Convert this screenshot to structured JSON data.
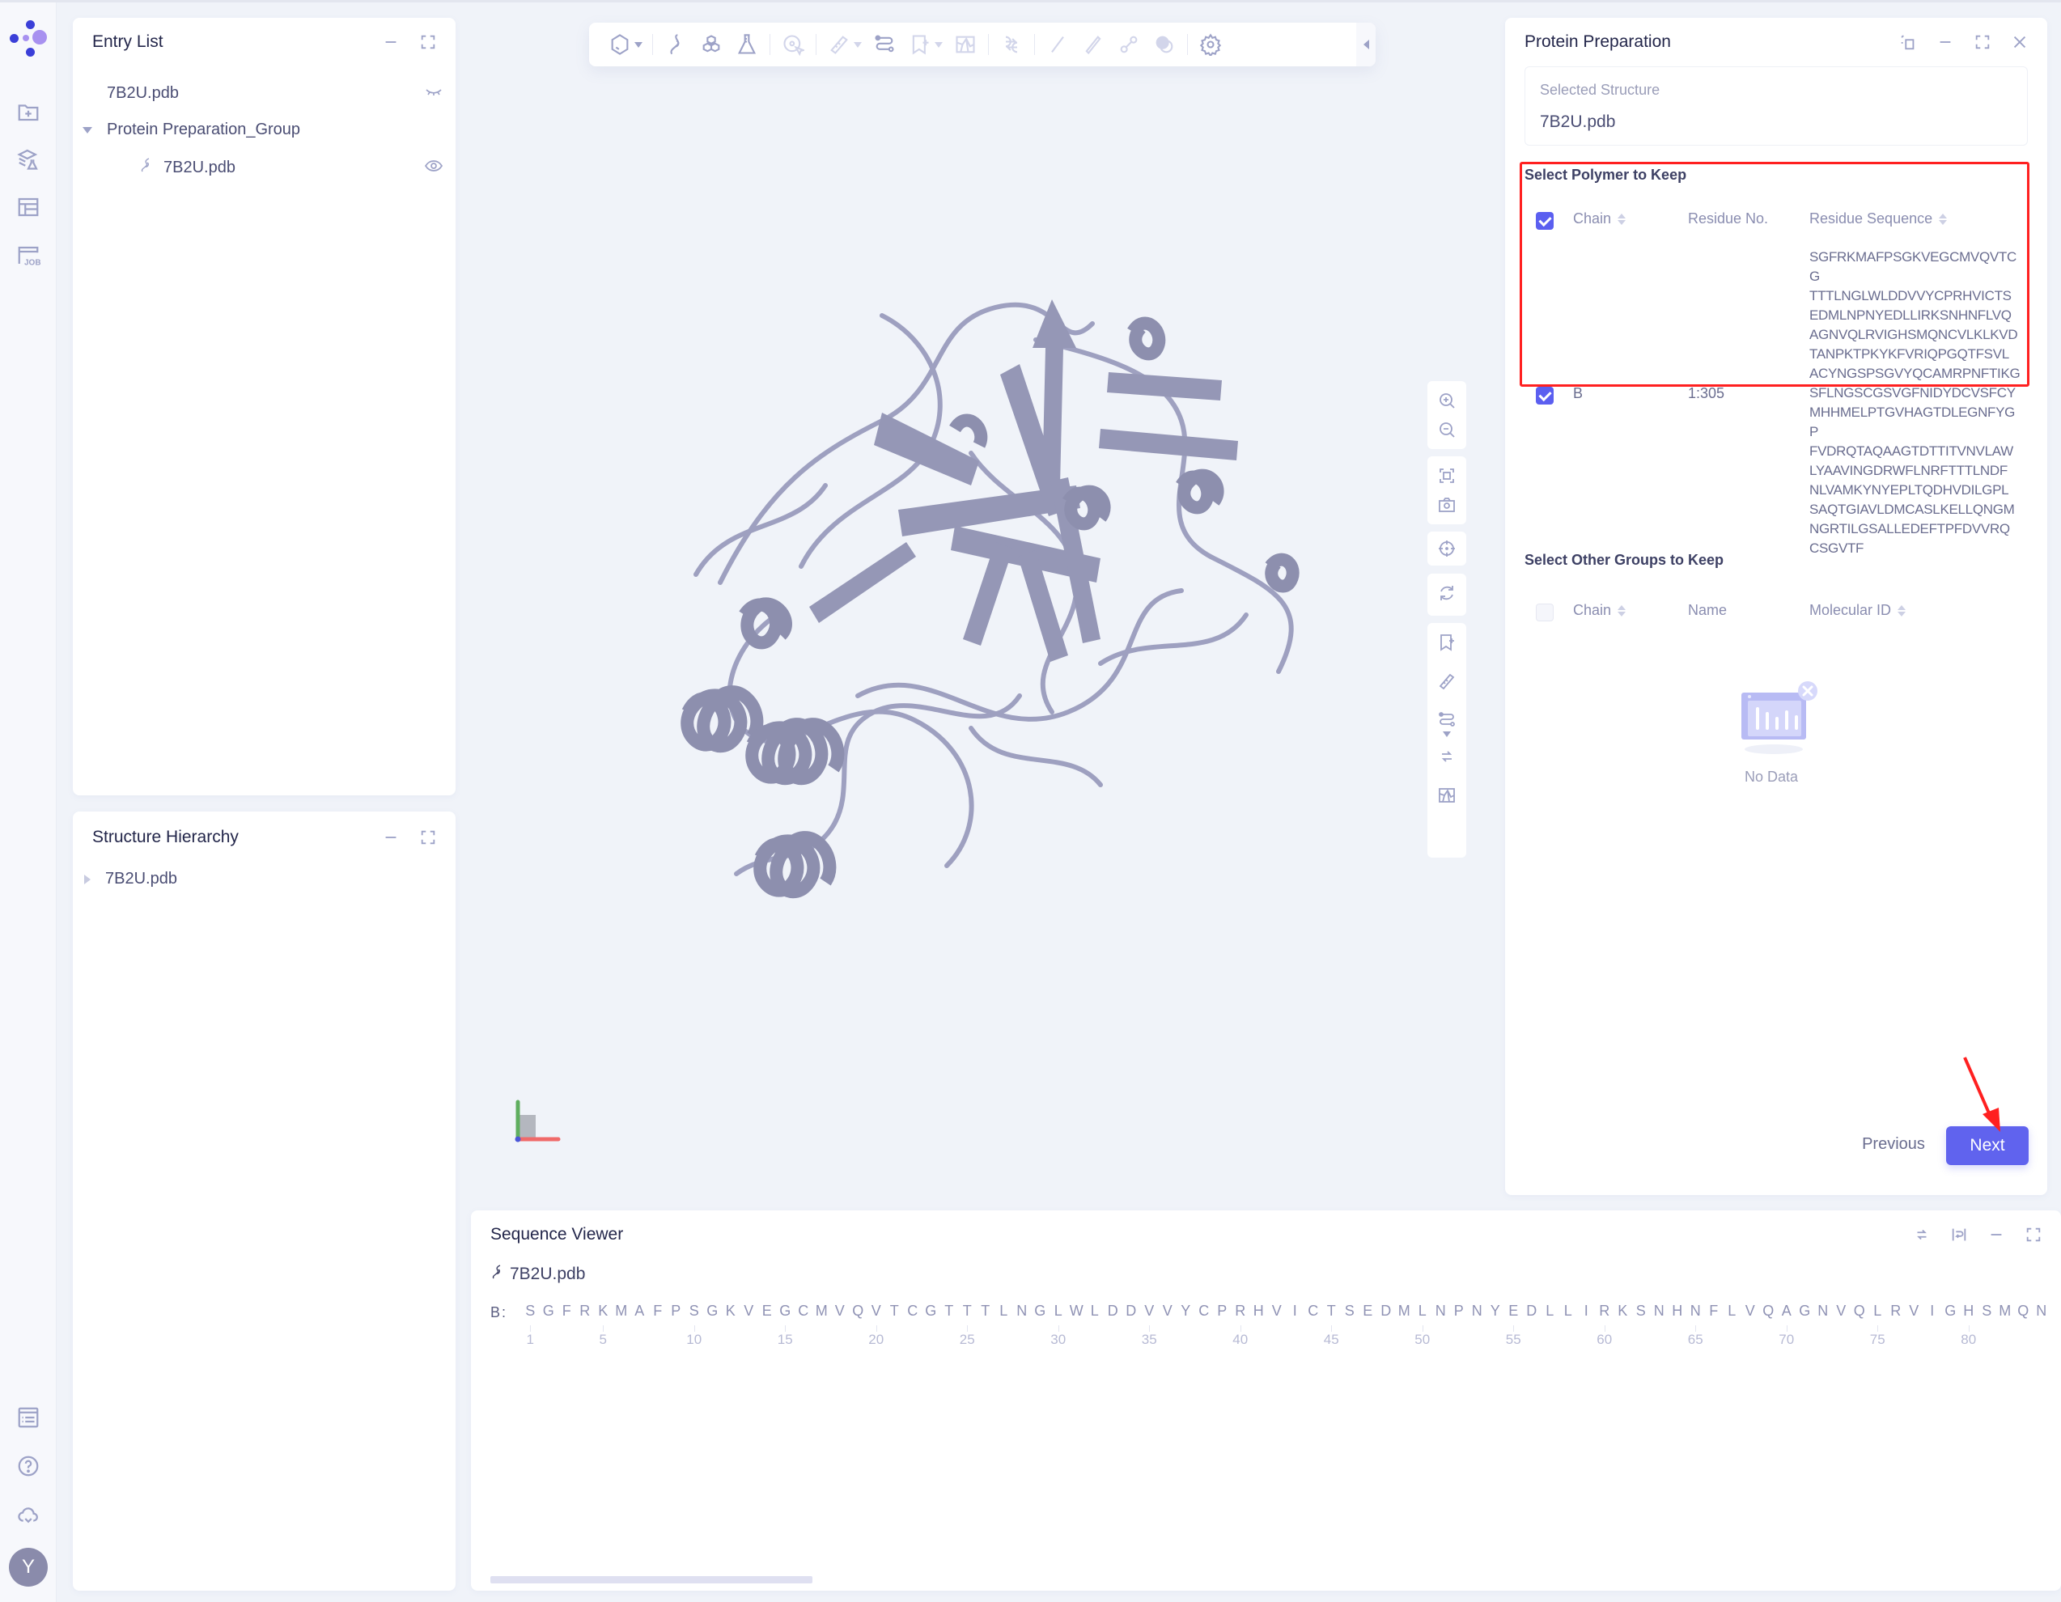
{
  "rail": {
    "top_icons": [
      "folder-plus-icon",
      "layers-flask-icon",
      "layout-icon",
      "job-icon"
    ],
    "bottom_icons": [
      "task-list-icon",
      "help-icon",
      "cloud-check-icon"
    ],
    "avatar_initial": "Y"
  },
  "entry_list": {
    "title": "Entry List",
    "items": [
      {
        "label": "7B2U.pdb",
        "visibility": "hidden"
      },
      {
        "label": "Protein Preparation_Group",
        "expanded": true
      },
      {
        "label": "7B2U.pdb",
        "visibility": "visible"
      }
    ]
  },
  "structure_hierarchy": {
    "title": "Structure Hierarchy",
    "items": [
      {
        "label": "7B2U.pdb",
        "expanded": false
      }
    ]
  },
  "viewer": {
    "toolbar_icons": [
      "display-mode-icon",
      "ribbon-icon",
      "molecule-icon",
      "flask-icon",
      "select-target-icon",
      "measure-icon",
      "path-icon",
      "bookmark-add-icon",
      "surface-icon",
      "align-icon",
      "line-icon",
      "pill-icon",
      "bond-icon",
      "overlay-icon",
      "settings-icon"
    ],
    "side_tools": [
      "zoom-in-icon",
      "zoom-out-icon",
      "fit-screen-icon",
      "screenshot-icon",
      "center-icon",
      "reset-rotate-icon",
      "bookmark-add-icon",
      "measure-icon",
      "path-icon",
      "align-icon",
      "surface-icon"
    ],
    "protein_color": "#9a9cbd"
  },
  "protein_prep": {
    "title": "Protein Preparation",
    "selected_structure_label": "Selected Structure",
    "selected_structure_value": "7B2U.pdb",
    "polymer_section_title": "Select Polymer to Keep",
    "polymer_columns": {
      "chain": "Chain",
      "residue_no": "Residue No.",
      "residue_sequence": "Residue Sequence"
    },
    "polymer_rows": [
      {
        "checked": true,
        "chain": "B",
        "residue_no": "1:305",
        "residue_sequence": "SGFRKMAFPSGKVEGCMVQVTCGTTTLNGLWLDDVVYCPRHVICTSEDMLNPNYEDLLIRKSNHNFLVQAGNVQLRVIGHSMQNCVLKLKVDTANPKTPKYKFVRIQPGQTFSVLACYNGSPSGVYQCAMRPNFTIKGSFLNGSCGSVGFNIDYDCVSFCYMHHMELPTGVHAGTDLEGNFYGPFVDRQTAQAAGTDTTITVNVLAWLYAAVINGDRWFLNRFTTTLNDFNLVAMKYNYEPLTQDHVDILGPLSAQTGIAVLDMCASLKELLQNGMNGRTILGSALLEDEFTPFDVVRQCSGVTF"
      }
    ],
    "header_checkbox_checked": true,
    "other_section_title": "Select Other Groups to Keep",
    "other_columns": {
      "chain": "Chain",
      "name": "Name",
      "molecular_id": "Molecular ID"
    },
    "other_empty_text": "No Data",
    "previous_label": "Previous",
    "next_label": "Next",
    "accent_color": "#6063ee",
    "highlight_color": "#ff2020"
  },
  "sequence_viewer": {
    "title": "Sequence Viewer",
    "file": "7B2U.pdb",
    "chain_label": "B:",
    "residues": "SGFRKMAFPSGKVEGCMVQVTCGTTTLNGLWLDDVVYCPRHVICTSEDMLNPNYEDLLIRKSNHNFLVQAGNVQLRVIGHSMQN",
    "tick_labels": [
      "1",
      "5",
      "10",
      "15",
      "20",
      "25",
      "30",
      "35",
      "40",
      "45",
      "50",
      "55",
      "60",
      "65",
      "70",
      "75",
      "80"
    ]
  }
}
